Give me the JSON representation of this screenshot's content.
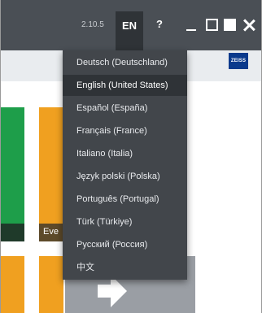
{
  "titlebar": {
    "version": "2.10.5",
    "language_button": "EN",
    "help_label": "?"
  },
  "brand": {
    "logo_text": "ZEISS"
  },
  "background": {
    "tile_text": "Eve"
  },
  "language_menu": {
    "items": [
      "Deutsch (Deutschland)",
      "English (United States)",
      "Español (España)",
      "Français (France)",
      "Italiano (Italia)",
      "Język polski (Polska)",
      "Português (Portugal)",
      "Türk (Türkiye)",
      "Русский (Россия)",
      "中文"
    ],
    "selected_index": 1
  },
  "colors": {
    "titlebar": "#4a4f55",
    "menu_bg": "#42464b",
    "menu_selected": "#2f3337",
    "tile_green": "#1e9e4a",
    "tile_orange": "#f0a020",
    "tile_gray": "#9a9ea4",
    "zeiss_blue": "#0b3a8c"
  }
}
